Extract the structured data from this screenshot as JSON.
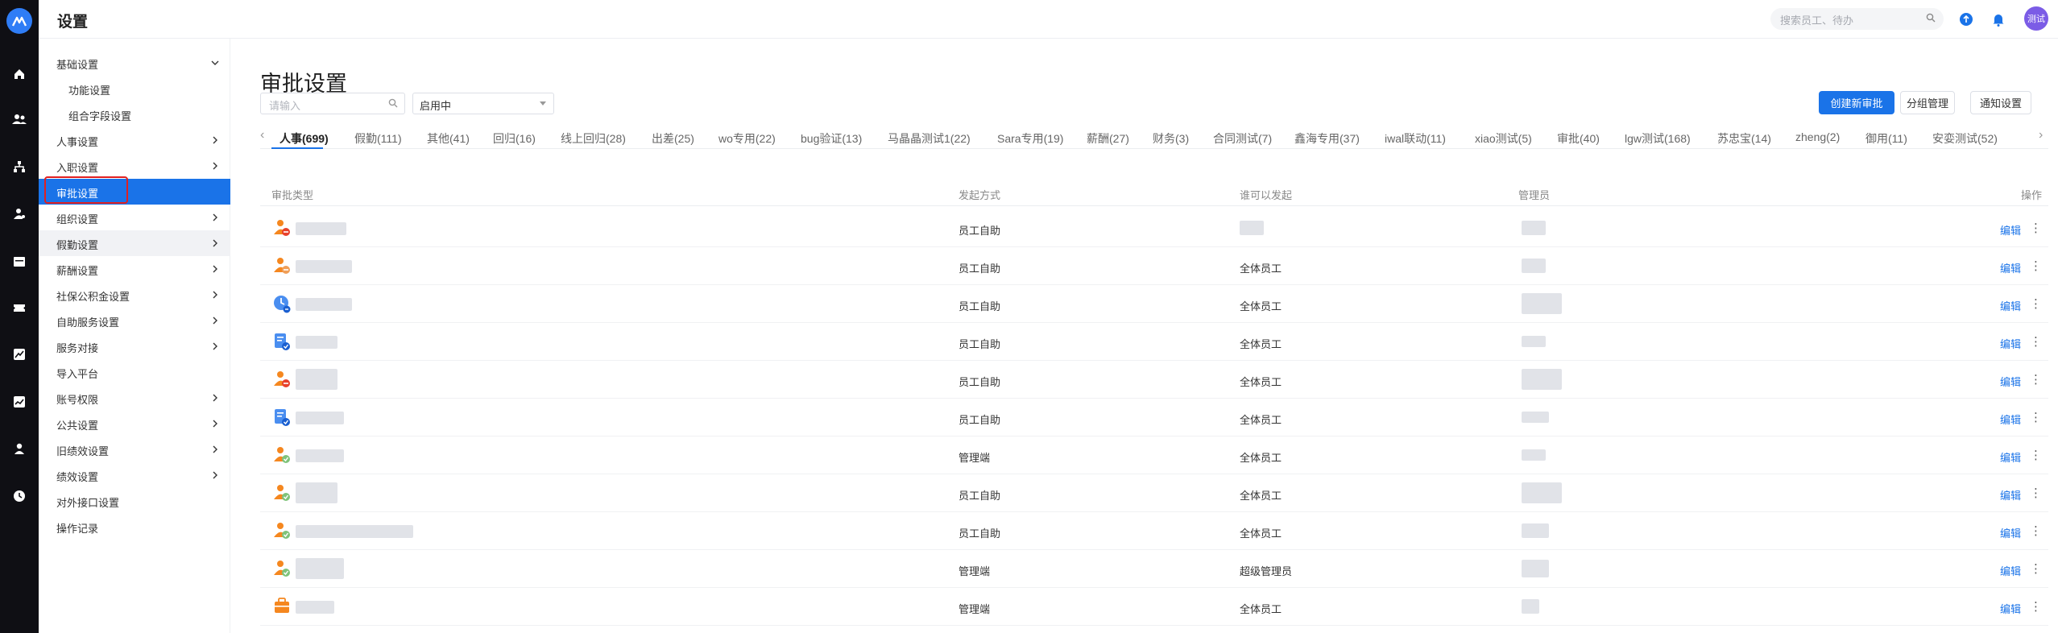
{
  "app": {
    "logo_icon": "app-logo-icon"
  },
  "header": {
    "title": "设置",
    "search_placeholder": "搜索员工、待办",
    "avatar_text": "测试"
  },
  "rail": {
    "icons": [
      "home-icon",
      "people-icon",
      "org-chart-icon",
      "user-gear-icon",
      "calendar-icon",
      "ticket-icon",
      "chart-icon",
      "trend-icon",
      "person-icon",
      "clock-icon"
    ]
  },
  "sidebar": {
    "items": [
      {
        "label": "基础设置",
        "chevron": "down"
      },
      {
        "label": "功能设置",
        "sub": true
      },
      {
        "label": "组合字段设置",
        "sub": true
      },
      {
        "label": "人事设置",
        "chevron": "right"
      },
      {
        "label": "入职设置",
        "chevron": "right"
      },
      {
        "label": "审批设置",
        "active": true
      },
      {
        "label": "组织设置",
        "chevron": "right"
      },
      {
        "label": "假勤设置",
        "chevron": "right",
        "hover": true
      },
      {
        "label": "薪酬设置",
        "chevron": "right"
      },
      {
        "label": "社保公积金设置",
        "chevron": "right"
      },
      {
        "label": "自助服务设置",
        "chevron": "right"
      },
      {
        "label": "服务对接",
        "chevron": "right"
      },
      {
        "label": "导入平台"
      },
      {
        "label": "账号权限",
        "chevron": "right"
      },
      {
        "label": "公共设置",
        "chevron": "right"
      },
      {
        "label": "旧绩效设置",
        "chevron": "right"
      },
      {
        "label": "绩效设置",
        "chevron": "right"
      },
      {
        "label": "对外接口设置"
      },
      {
        "label": "操作记录"
      }
    ]
  },
  "main": {
    "title": "审批设置",
    "filter": {
      "input_placeholder": "请输入",
      "status_value": "启用中"
    },
    "buttons": {
      "create": "创建新审批",
      "group": "分组管理",
      "notify": "通知设置"
    },
    "tabs": [
      "人事(699)",
      "假勤(111)",
      "其他(41)",
      "回归(16)",
      "线上回归(28)",
      "出差(25)",
      "wo专用(22)",
      "bug验证(13)",
      "马晶晶测试1(22)",
      "Sara专用(19)",
      "薪酬(27)",
      "财务(3)",
      "合同测试(7)",
      "鑫海专用(37)",
      "iwal联动(11)",
      "xiao测试(5)",
      "审批(40)",
      "lgw测试(168)",
      "苏忠宝(14)",
      "zheng(2)",
      "御用(11)",
      "安娈测试(52)"
    ],
    "table": {
      "headers": {
        "type": "审批类型",
        "method": "发起方式",
        "who": "谁可以发起",
        "admin": "管理员",
        "ops": "操作"
      },
      "rows": [
        {
          "icon": "person-minus-icon",
          "method": "员工自助",
          "who": "",
          "edit": "编辑"
        },
        {
          "icon": "person-minus-icon",
          "method": "员工自助",
          "who": "全体员工",
          "edit": "编辑"
        },
        {
          "icon": "clock-badge-icon",
          "method": "员工自助",
          "who": "全体员工",
          "edit": "编辑"
        },
        {
          "icon": "doc-check-icon",
          "method": "员工自助",
          "who": "全体员工",
          "edit": "编辑"
        },
        {
          "icon": "person-minus-icon",
          "method": "员工自助",
          "who": "全体员工",
          "edit": "编辑"
        },
        {
          "icon": "doc-check-icon",
          "method": "员工自助",
          "who": "全体员工",
          "edit": "编辑"
        },
        {
          "icon": "person-check-icon",
          "method": "管理端",
          "who": "全体员工",
          "edit": "编辑"
        },
        {
          "icon": "person-check-icon",
          "method": "员工自助",
          "who": "全体员工",
          "edit": "编辑"
        },
        {
          "icon": "person-check-icon",
          "method": "员工自助",
          "who": "全体员工",
          "edit": "编辑"
        },
        {
          "icon": "person-check-icon",
          "method": "管理端",
          "who": "超级管理员",
          "edit": "编辑"
        },
        {
          "icon": "briefcase-icon",
          "method": "管理端",
          "who": "全体员工",
          "edit": "编辑"
        }
      ]
    }
  },
  "colors": {
    "primary": "#1a73e8",
    "rail": "#0f0f14",
    "orange": "#f5871f",
    "highlight": "#e02020"
  }
}
